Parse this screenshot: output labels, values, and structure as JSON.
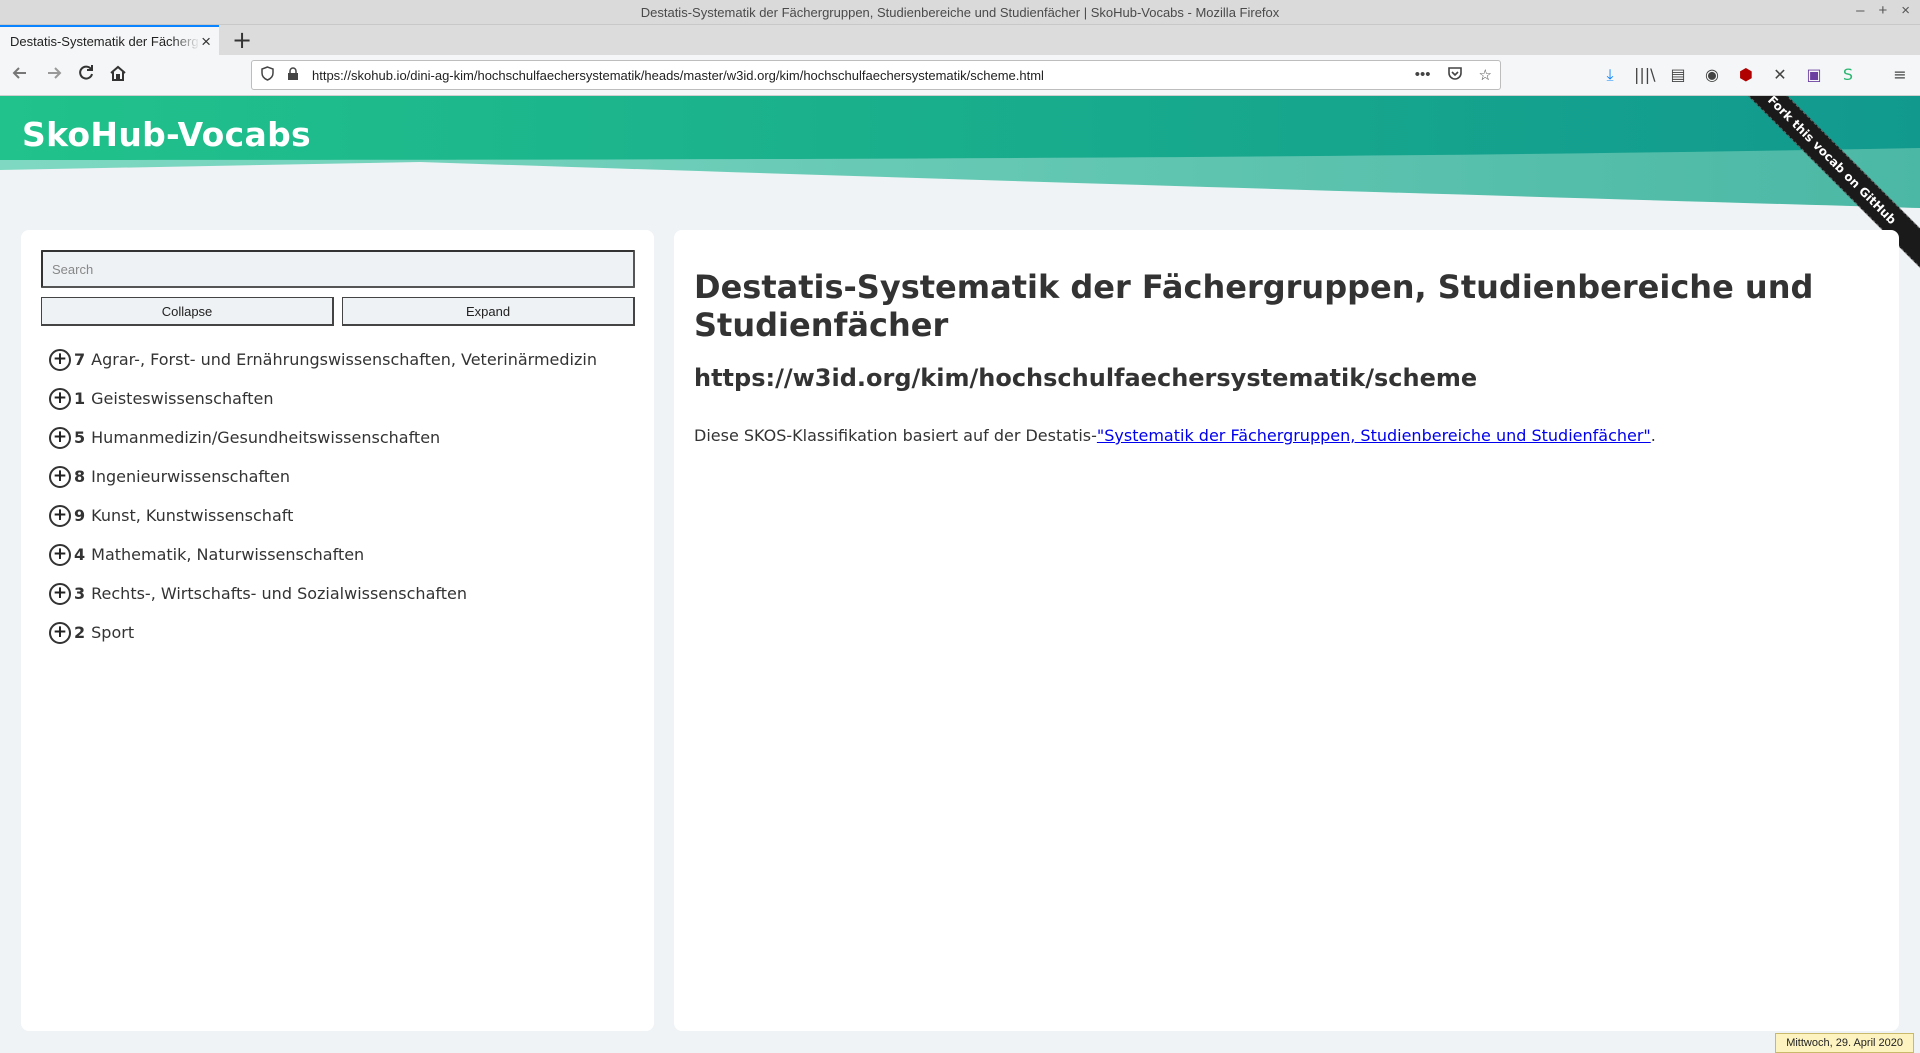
{
  "window": {
    "title": "Destatis-Systematik der Fächergruppen, Studienbereiche und Studienfächer | SkoHub-Vocabs - Mozilla Firefox",
    "controls": [
      "–",
      "+",
      "×"
    ]
  },
  "tabs": [
    {
      "label": "Destatis-Systematik der Fächergruppen, Studienbereiche und Studienfächer",
      "active": true
    }
  ],
  "navbar": {
    "url": "https://skohub.io/dini-ag-kim/hochschulfaechersystematik/heads/master/w3id.org/kim/hochschulfaechersystematik/scheme.html",
    "icons": [
      "back-icon",
      "forward-icon",
      "reload-icon",
      "home-icon",
      "shield-icon",
      "lock-icon",
      "more-icon",
      "pocket-icon",
      "bookmark-star-icon",
      "download-icon",
      "library-icon",
      "sidebar-icon",
      "account-icon",
      "ublock-icon",
      "extension-icon",
      "extension-icon",
      "extension-icon",
      "menu-icon"
    ]
  },
  "site": {
    "title": "SkoHub-Vocabs",
    "ribbon": "Fork this vocab on GitHub",
    "colors": {
      "header_start": "#21c28b",
      "header_end": "#11998e",
      "background": "#f0f3f6"
    }
  },
  "sidebar": {
    "search_placeholder": "Search",
    "collapse_label": "Collapse",
    "expand_label": "Expand",
    "concepts": [
      {
        "notation": "7",
        "label": "Agrar-, Forst- und Ernährungswissenschaften, Veterinärmedizin"
      },
      {
        "notation": "1",
        "label": "Geisteswissenschaften"
      },
      {
        "notation": "5",
        "label": "Humanmedizin/Gesundheitswissenschaften"
      },
      {
        "notation": "8",
        "label": "Ingenieurwissenschaften"
      },
      {
        "notation": "9",
        "label": "Kunst, Kunstwissenschaft"
      },
      {
        "notation": "4",
        "label": "Mathematik, Naturwissenschaften"
      },
      {
        "notation": "3",
        "label": "Rechts-, Wirtschafts- und Sozialwissenschaften"
      },
      {
        "notation": "2",
        "label": "Sport"
      }
    ]
  },
  "main": {
    "title": "Destatis-Systematik der Fächergruppen, Studienbereiche und Studienfächer",
    "uri": "https://w3id.org/kim/hochschulfaechersystematik/scheme",
    "description_prefix": "Diese SKOS-Klassifikation basiert auf der Destatis-",
    "description_link": "\"Systematik der Fächergruppen, Studienbereiche und Studienfächer\"",
    "description_suffix": "."
  },
  "taskbar": {
    "clock": "Mittwoch, 29. April 2020"
  }
}
